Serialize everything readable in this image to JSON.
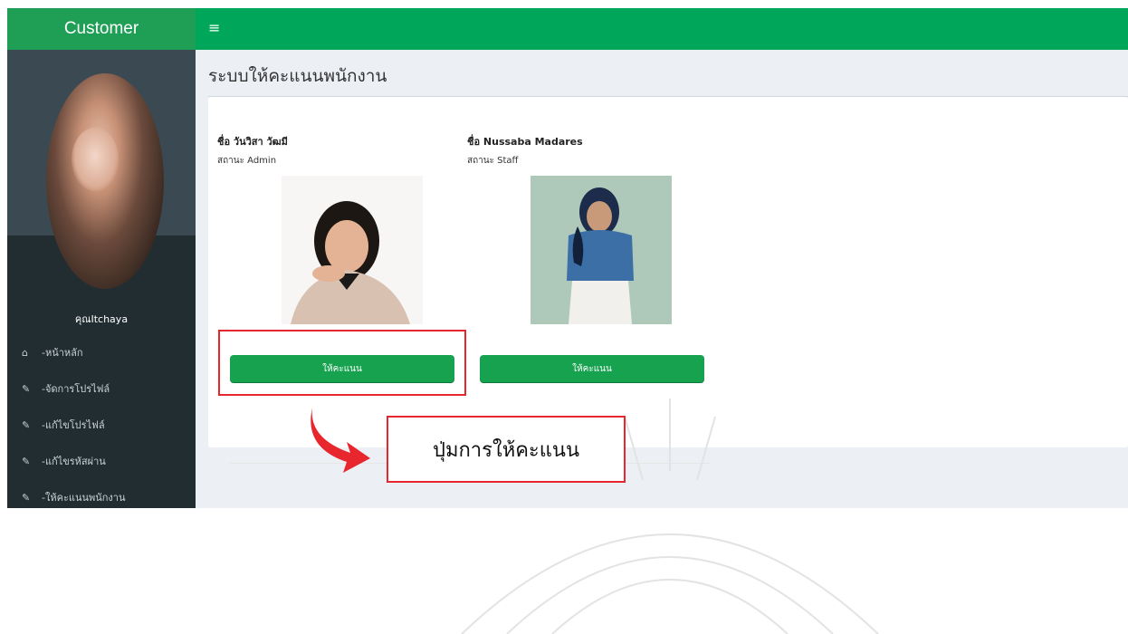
{
  "sidebar": {
    "brand": "Customer",
    "user_name": "คุณItchaya",
    "menu": [
      {
        "icon": "home-icon",
        "label": "-หน้าหลัก"
      },
      {
        "icon": "edit-icon",
        "label": "-จัดการโปรไฟล์"
      },
      {
        "icon": "edit-icon",
        "label": "-แก้ไขโปรไฟล์"
      },
      {
        "icon": "edit-icon",
        "label": "-แก้ไขรหัสผ่าน"
      },
      {
        "icon": "edit-icon",
        "label": "-ให้คะแนนพนักงาน"
      }
    ]
  },
  "topbar": {
    "menu_icon": "hamburger-icon"
  },
  "page": {
    "title": "ระบบให้คะแนนพนักงาน"
  },
  "staff": [
    {
      "name": "ชื่อ วันวิสา วัฒมี",
      "status": "สถานะ Admin",
      "button": "ให้คะแนน"
    },
    {
      "name": "ชื่อ Nussaba Madares",
      "status": "สถานะ Staff",
      "button": "ให้คะแนน"
    }
  ],
  "annotation": {
    "callout": "ปุ่มการให้คะแนน",
    "color": "#e8262d"
  },
  "colors": {
    "brand": "#1f9f55",
    "topbar": "#00a65a",
    "sidebar": "#222d32",
    "button": "#17a24f"
  }
}
